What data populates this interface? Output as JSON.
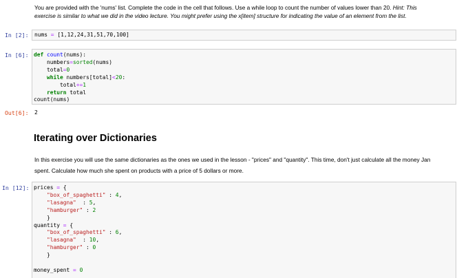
{
  "md_top": {
    "line1_a": "You are provided with the 'nums' list. Complete the code in the cell that follows. Use a while loop to count the number of values lower than 20. ",
    "line1_hint": "Hint: This",
    "line2": "exercise is similar to what we did in the video lecture. You might prefer using the x[item] structure for indicating the value of an element from the list."
  },
  "cell2": {
    "prompt": "In [2]:",
    "var": "nums",
    "op": "=",
    "value": "[1,12,24,31,51,70,100]"
  },
  "cell6": {
    "prompt": "In [6]:",
    "kw_def": "def",
    "fn_name": "count",
    "params": "(nums):",
    "l2_a": "    numbers",
    "l2_op": "=",
    "l2_b": "sorted",
    "l2_c": "(nums)",
    "l3_a": "    total",
    "l3_op": "=",
    "l3_num": "0",
    "kw_while": "while",
    "l4_b": " numbers[total]",
    "l4_op": "<",
    "l4_num": "20",
    "l4_c": ":",
    "l5_a": "        total",
    "l5_op": "+=",
    "l5_num": "1",
    "kw_return": "return",
    "l6_b": " total",
    "l7": "count(nums)"
  },
  "out6": {
    "prompt": "Out[6]:",
    "value": "2"
  },
  "heading": "Iterating over Dictionaries",
  "md_mid": {
    "line1": "In this exercise you will use the same dictionaries as the ones we used in the lesson - \"prices\" and \"quantity\". This time, don't just calculate all the money Jan",
    "line2": "spent. Calculate how much she spent on products with a price of 5 dollars or more."
  },
  "cell12": {
    "prompt": "In [12]:",
    "prices": "prices",
    "eq": "=",
    "brace_open": "{",
    "brace_close": "}",
    "k1": "\"box_of_spaghetti\"",
    "k2": "\"lasagna\"",
    "k3": "\"hamburger\"",
    "p1": "4",
    "p2": "5",
    "p3": "2",
    "quantity": "quantity",
    "q1": "6",
    "q2": "10",
    "q3": "0",
    "money": "money_spent",
    "money_val": "0"
  }
}
